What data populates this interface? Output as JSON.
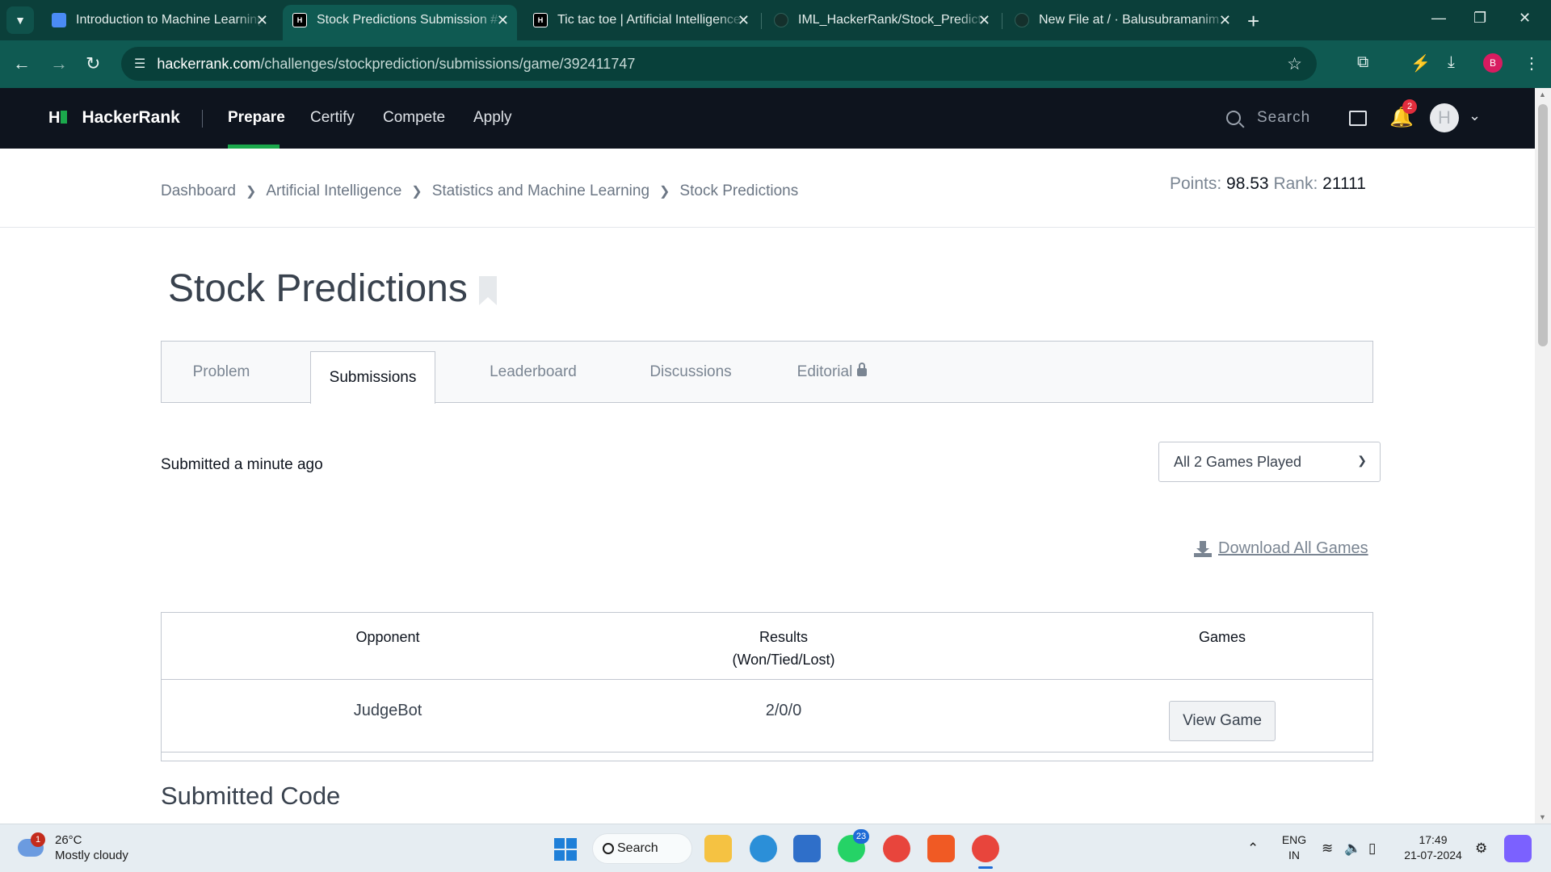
{
  "browser": {
    "tabs": [
      {
        "title": "Introduction to Machine Learning",
        "favicon": "google-doc-icon"
      },
      {
        "title": "Stock Predictions Submission #",
        "favicon": "hackerrank-icon",
        "active": true
      },
      {
        "title": "Tic tac toe | Artificial Intelligence",
        "favicon": "hackerrank-icon"
      },
      {
        "title": "IML_HackerRank/Stock_Predictions",
        "favicon": "github-icon"
      },
      {
        "title": "New File at / · Balusubramanim",
        "favicon": "github-icon"
      }
    ],
    "url_host": "hackerrank.com",
    "url_path": "/challenges/stockprediction/submissions/game/392411747",
    "profile_initial": "B"
  },
  "hr_header": {
    "brand": "HackerRank",
    "nav": [
      "Prepare",
      "Certify",
      "Compete",
      "Apply"
    ],
    "active_nav": "Prepare",
    "search_placeholder": "Search",
    "notification_count": "2",
    "avatar_initial": "H"
  },
  "breadcrumb": [
    "Dashboard",
    "Artificial Intelligence",
    "Statistics and Machine Learning",
    "Stock Predictions"
  ],
  "stats": {
    "points_label": "Points:",
    "points_value": "98.53",
    "rank_label": "Rank:",
    "rank_value": "21111"
  },
  "challenge": {
    "title": "Stock Predictions",
    "tabs": [
      "Problem",
      "Submissions",
      "Leaderboard",
      "Discussions",
      "Editorial"
    ],
    "active_tab": "Submissions"
  },
  "submission": {
    "submitted_text": "Submitted a minute ago",
    "games_filter": "All 2 Games Played",
    "download_label": "Download All Games",
    "table": {
      "headers": {
        "opponent": "Opponent",
        "results_line1": "Results",
        "results_line2": "(Won/Tied/Lost)",
        "games": "Games"
      },
      "rows": [
        {
          "opponent": "JudgeBot",
          "results": "2/0/0",
          "action": "View Game"
        }
      ]
    },
    "code_section_title": "Submitted Code"
  },
  "taskbar": {
    "weather_temp": "26°C",
    "weather_desc": "Mostly cloudy",
    "weather_badge": "1",
    "search_label": "Search",
    "whatsapp_badge": "23",
    "lang_line1": "ENG",
    "lang_line2": "IN",
    "time": "17:49",
    "date": "21-07-2024"
  },
  "colors": {
    "browser_frame": "#0b3f3a",
    "hr_header_bg": "#0e141e",
    "hr_accent": "#1ba94c",
    "text_muted": "#7a8592"
  }
}
